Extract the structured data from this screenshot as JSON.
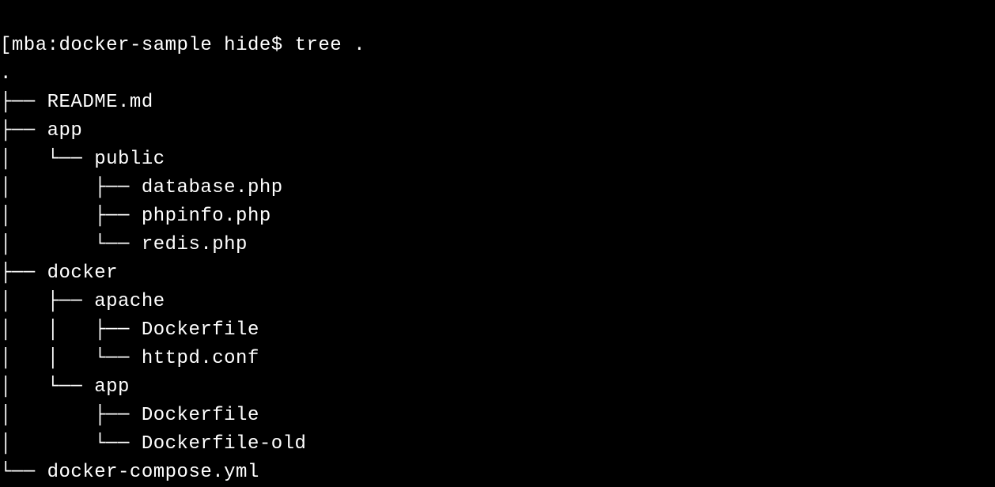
{
  "prompt": {
    "leading_bracket": "[",
    "host": "mba",
    "separator1": ":",
    "directory": "docker-sample",
    "user": "hide",
    "separator2": "$",
    "command": "tree ."
  },
  "tree": {
    "root": ".",
    "lines": [
      "├── README.md",
      "├── app",
      "│   └── public",
      "│       ├── database.php",
      "│       ├── phpinfo.php",
      "│       └── redis.php",
      "├── docker",
      "│   ├── apache",
      "│   │   ├── Dockerfile",
      "│   │   └── httpd.conf",
      "│   └── app",
      "│       ├── Dockerfile",
      "│       └── Dockerfile-old",
      "└── docker-compose.yml"
    ]
  }
}
